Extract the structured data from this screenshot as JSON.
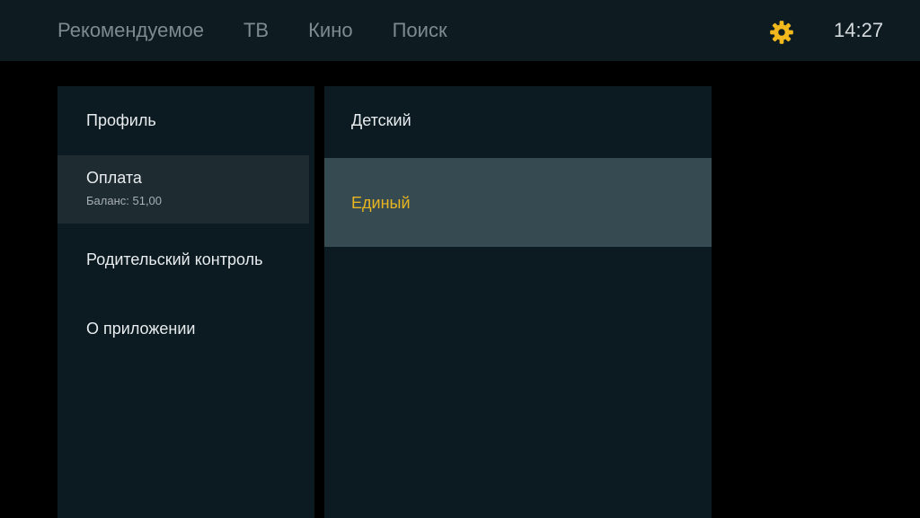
{
  "nav": {
    "items": [
      {
        "label": "Рекомендуемое"
      },
      {
        "label": "ТВ"
      },
      {
        "label": "Кино"
      },
      {
        "label": "Поиск"
      }
    ]
  },
  "header": {
    "settings_icon": "gear-icon",
    "clock": "14:27",
    "accent_color": "#f0b81c"
  },
  "menu": {
    "profile": {
      "label": "Профиль"
    },
    "payment": {
      "label": "Оплата",
      "balance": "Баланс: 51,00"
    },
    "parental": {
      "label": "Родительский контроль"
    },
    "about": {
      "label": "О приложении"
    }
  },
  "options": {
    "kids": {
      "label": "Детский"
    },
    "single": {
      "label": "Единый"
    }
  }
}
